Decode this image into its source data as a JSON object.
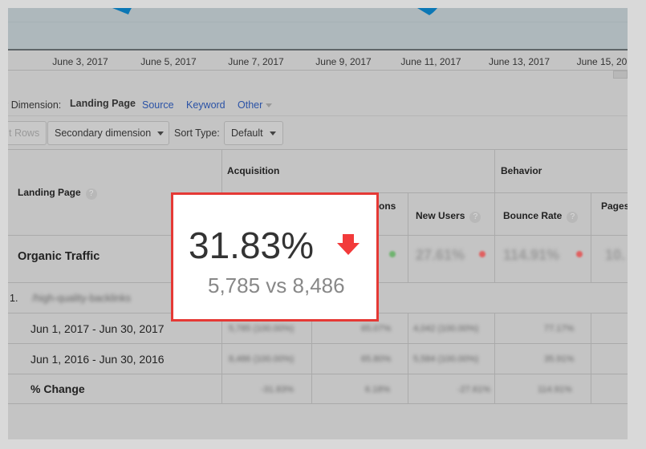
{
  "chart": {
    "x_ticks": [
      "June 3, 2017",
      "June 5, 2017",
      "June 7, 2017",
      "June 9, 2017",
      "June 11, 2017",
      "June 13, 2017",
      "June 15, 20"
    ],
    "line_color": "#0b77b5"
  },
  "dimension": {
    "label": "y Dimension:",
    "active": "Landing Page",
    "options": [
      "Source",
      "Keyword",
      "Other"
    ]
  },
  "toolbar": {
    "rows_label": "t Rows",
    "secondary": "Secondary dimension",
    "sort_label": "Sort Type:",
    "sort_value": "Default"
  },
  "table": {
    "col_landing": "Landing Page",
    "group_acq": "Acquisition",
    "group_beh": "Behavior",
    "col_sessions_partial": "ons",
    "col_new_users": "New Users",
    "col_bounce": "Bounce Rate",
    "col_pages": "Pages",
    "organic": {
      "label": "Organic Traffic",
      "new_users": "27.61%",
      "bounce": "114.91%",
      "pages": "10."
    },
    "row1": {
      "index": "1.",
      "page": "/high-quality-backlinks"
    },
    "rows": [
      {
        "label": "Jun 1, 2017 - Jun 30, 2017",
        "c1": "5,785 (100.00%)",
        "c2": "65.07%",
        "c3": "4,042 (100.00%)",
        "c4": "77.17%"
      },
      {
        "label": "Jun 1, 2016 - Jun 30, 2016",
        "c1": "8,486 (100.00%)",
        "c2": "65.80%",
        "c3": "5,584 (100.00%)",
        "c4": "35.91%"
      },
      {
        "label": "% Change",
        "c1": "-31.83%",
        "c2": "6.18%",
        "c3": "-27.61%",
        "c4": "114.91%"
      }
    ]
  },
  "popup": {
    "percent": "31.83%",
    "comparison": "5,785 vs 8,486",
    "arrow_color": "#f23a3a",
    "border_color": "#e53935"
  }
}
